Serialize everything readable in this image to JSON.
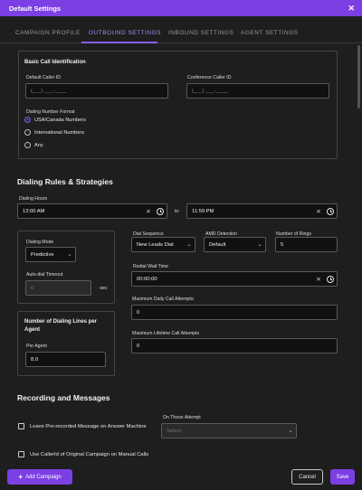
{
  "window": {
    "title": "Default Settings",
    "close_icon": "close-icon"
  },
  "tabs": [
    {
      "label": "CAMPAIGN PROFILE",
      "active": false
    },
    {
      "label": "OUTBOUND SETTINGS",
      "active": true
    },
    {
      "label": "INBOUND SETTINGS",
      "active": false
    },
    {
      "label": "AGENT SETTINGS",
      "active": false
    }
  ],
  "basic_call_id": {
    "title": "Basic Call Identification",
    "default_caller_id": {
      "label": "Default Caller ID",
      "placeholder": "(___) ___-____"
    },
    "conference_caller_id": {
      "label": "Conference Caller ID",
      "placeholder": "(___) ___-____"
    },
    "number_format": {
      "label": "Dialing Number Format",
      "options": [
        {
          "label": "USA/Canada Numbers",
          "checked": true
        },
        {
          "label": "International Numbers",
          "checked": false
        },
        {
          "label": "Any",
          "checked": false
        }
      ]
    }
  },
  "dialing_rules": {
    "heading": "Dialing Rules & Strategies",
    "hours_label": "Dialing Hours",
    "hours_from": "12:00 AM",
    "hours_to_word": "to",
    "hours_to": "11:59 PM",
    "dialing_mode": {
      "label": "Dialing Mode",
      "value": "Predictive"
    },
    "auto_dial_timeout": {
      "label": "Auto-dial Timeout",
      "value": "0",
      "suffix": "sec"
    },
    "dial_sequence": {
      "label": "Dial Sequence",
      "value": "New Leads Dial"
    },
    "amd_detection": {
      "label": "AMD Detection",
      "value": "Default"
    },
    "number_of_rings": {
      "label": "Number of Rings",
      "value": "5"
    },
    "redial_wait_time": {
      "label": "Redial Wait Time",
      "value": "00:00:00"
    },
    "max_daily_attempts": {
      "label": "Maximum Daily Call Attempts:",
      "value": "0"
    },
    "max_lifetime_attempts": {
      "label": "Maximum Lifetime Call Attempts",
      "value": "0"
    },
    "lines_per_agent": {
      "title": "Number of Dialing Lines per Agent",
      "label": "Per Agent",
      "value": "8.0"
    }
  },
  "recording": {
    "heading": "Recording and Messages",
    "leave_message_label": "Leave Pre-recorded Message on Answer Machine",
    "attempt_label": "On These Attempt",
    "attempt_placeholder": "Select",
    "use_callerid_label": "Use CallerId of Original Campaign on Manual Calls"
  },
  "footer": {
    "add_campaign": "Add Campaign",
    "cancel": "Cancel",
    "save": "Save"
  },
  "colors": {
    "accent": "#7b3fe4",
    "background": "#1e1e1e",
    "field": "#111111"
  }
}
